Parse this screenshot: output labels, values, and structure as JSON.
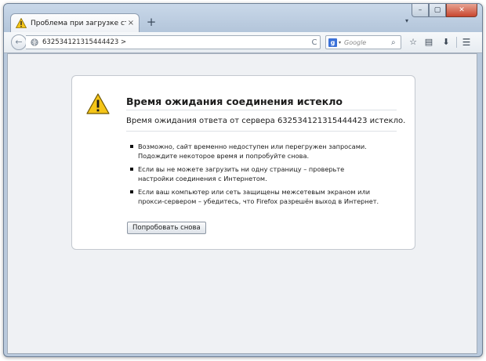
{
  "tab": {
    "title": "Проблема при загрузке страницы",
    "close_glyph": "×",
    "icon": "warning-triangle-icon"
  },
  "tabbar": {
    "new_tab_glyph": "+",
    "list_glyph": "▾"
  },
  "window_controls": {
    "minimize_glyph": "–",
    "maximize_glyph": "▢",
    "close_glyph": "✕"
  },
  "navbar": {
    "back_glyph": "←",
    "url": "632534121315444423 >",
    "reload_glyph": "C",
    "search": {
      "engine_glyph": "g",
      "engine_dropdown_glyph": "▾",
      "placeholder": "Google",
      "glass_glyph": "⌕"
    },
    "tools": [
      {
        "name": "bookmark-star-icon",
        "glyph": "☆"
      },
      {
        "name": "bookmarks-menu-icon",
        "glyph": "▤"
      },
      {
        "name": "downloads-icon",
        "glyph": "⬇"
      },
      {
        "name": "menu-icon",
        "glyph": "☰"
      }
    ]
  },
  "error": {
    "title": "Время ожидания соединения истекло",
    "description": "Время ожидания ответа от сервера 632534121315444423 истекло.",
    "tips": [
      "Возможно, сайт временно недоступен или перегружен запросами. Подождите некоторое время и попробуйте снова.",
      "Если вы не можете загрузить ни одну страницу – проверьте настройки соединения с Интернетом.",
      "Если ваш компьютер или сеть защищены межсетевым экраном или прокси-сервером – убедитесь, что Firefox разрешён выход в Интернет."
    ],
    "try_again_label": "Попробовать снова"
  },
  "colors": {
    "warning_yellow": "#f5c518",
    "window_frame": "#b9c9dc",
    "content_bg": "#eff1f4"
  }
}
